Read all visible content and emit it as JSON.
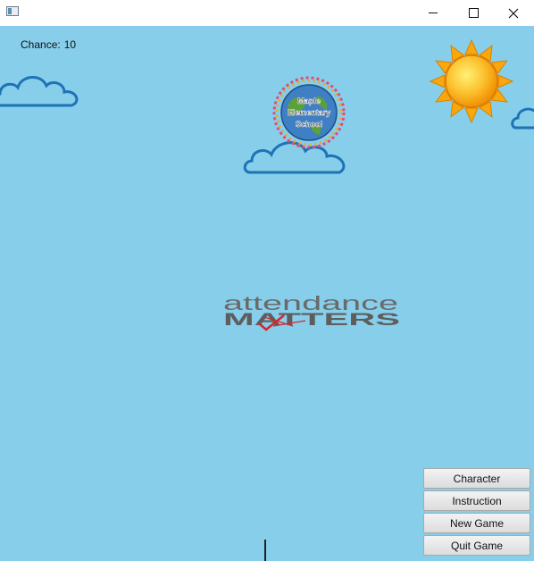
{
  "window": {
    "title": ""
  },
  "hud": {
    "chance_label": "Chance:",
    "chance_value": "10"
  },
  "school_badge": {
    "line1": "Maple",
    "line2": "Elementary",
    "line3": "School"
  },
  "banner": {
    "line1": "attendance",
    "line2": "MATTERS"
  },
  "menu": {
    "character": "Character",
    "instruction": "Instruction",
    "new_game": "New Game",
    "quit_game": "Quit Game"
  },
  "colors": {
    "sky": "#87ceeb",
    "cloud_outline": "#1e73b4",
    "sun": "#f9b700",
    "banner_text": "#666666",
    "banner_accent": "#d7262e"
  },
  "icons": [
    "app-icon",
    "minimize-icon",
    "maximize-icon",
    "close-icon",
    "sun-icon",
    "cloud-icon"
  ]
}
